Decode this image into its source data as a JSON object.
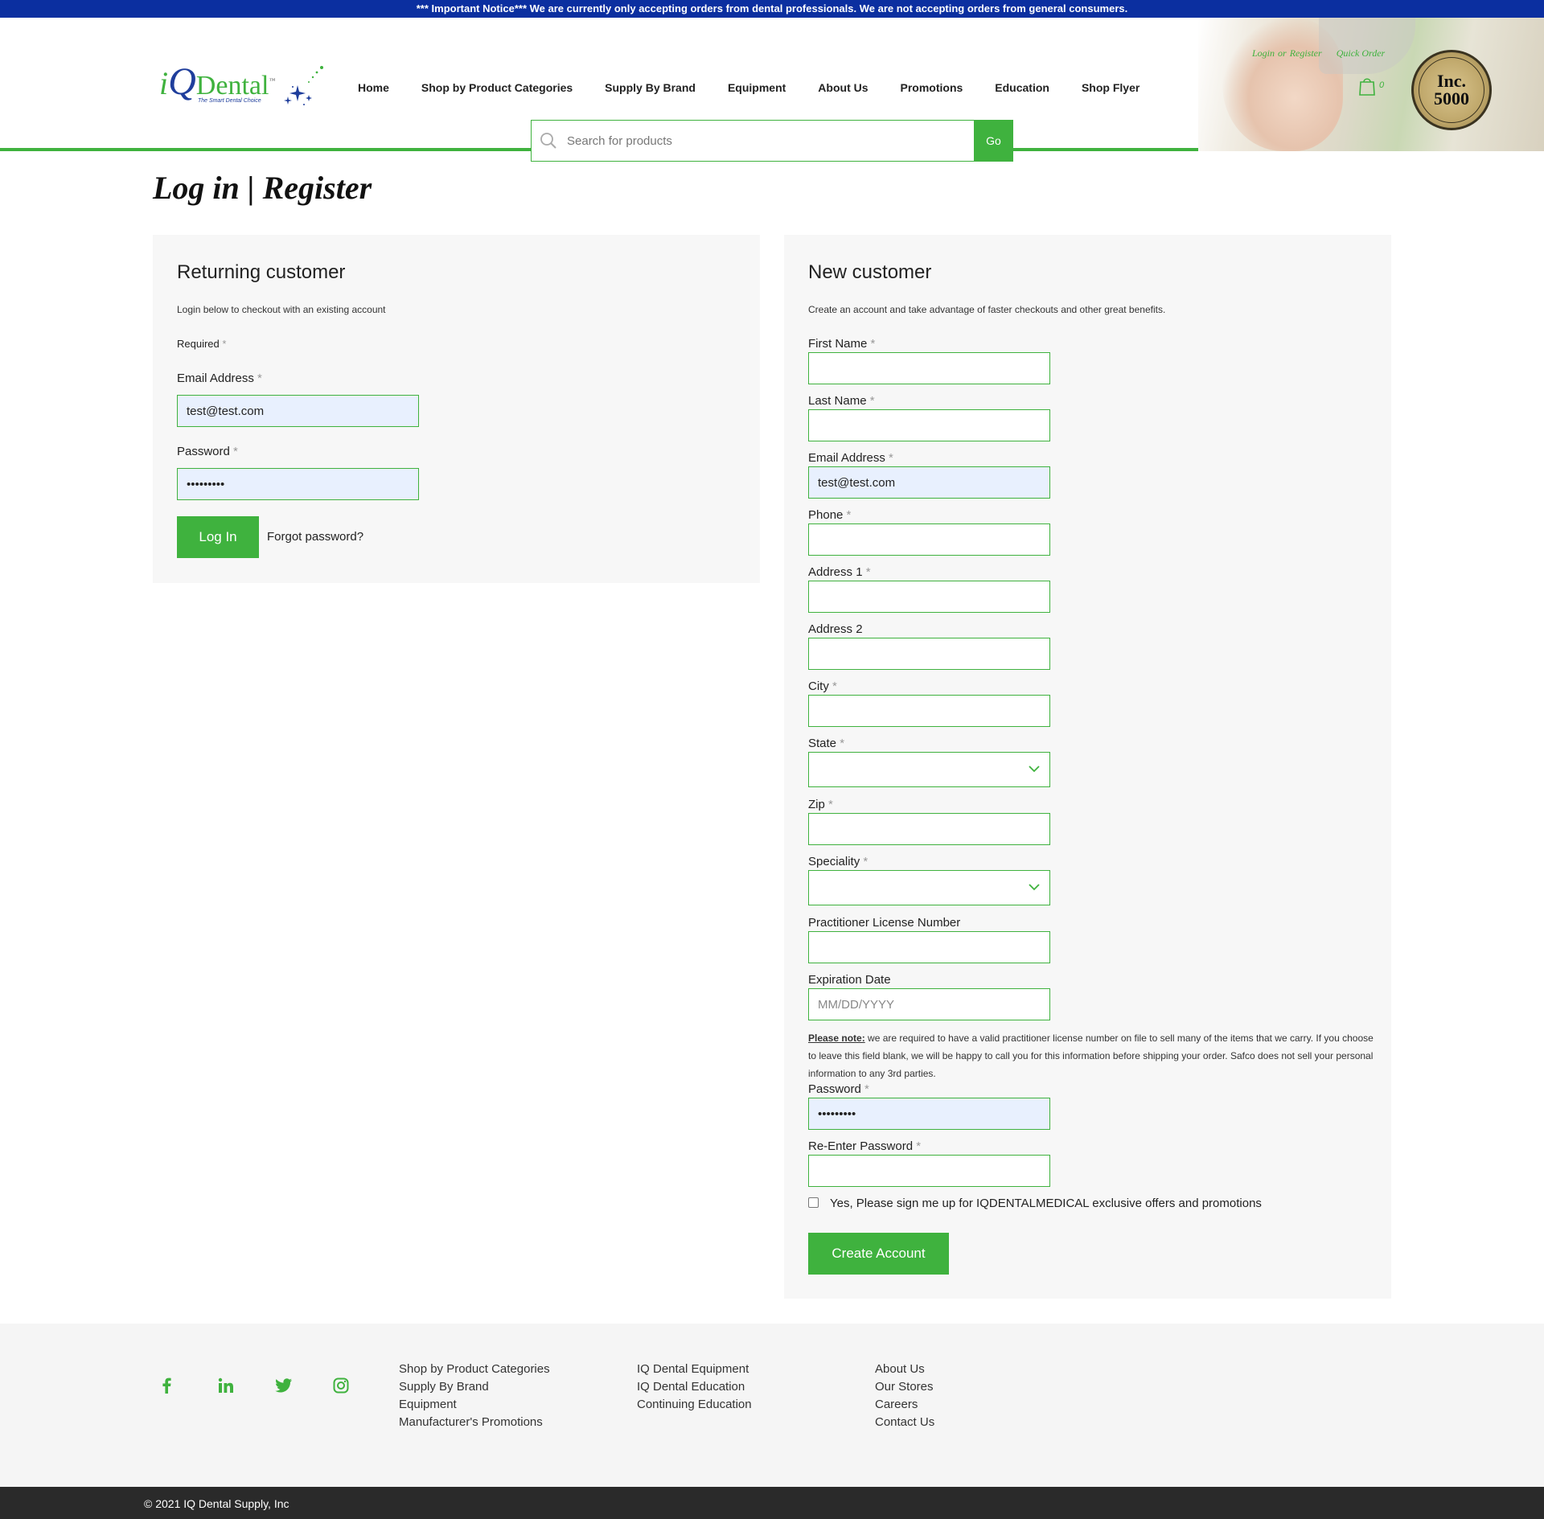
{
  "notice": "*** Important Notice*** We are currently only accepting orders from dental professionals. We are not accepting orders from general consumers.",
  "logo": {
    "i": "i",
    "q": "Q",
    "dental": "Dental",
    "tm": "™",
    "tagline": "The Smart Dental Choice"
  },
  "nav": [
    {
      "label": "Home"
    },
    {
      "label": "Shop by Product Categories"
    },
    {
      "label": "Supply By Brand"
    },
    {
      "label": "Equipment"
    },
    {
      "label": "About Us"
    },
    {
      "label": "Promotions"
    },
    {
      "label": "Education"
    },
    {
      "label": "Shop Flyer"
    }
  ],
  "search": {
    "placeholder": "Search for products",
    "button": "Go"
  },
  "top_links": {
    "login": "Login",
    "or": "or",
    "register": "Register",
    "quick_order": "Quick Order",
    "cart_count": "0"
  },
  "badge": {
    "inc": "Inc.",
    "number": "5000",
    "ring_text": "AMERICA'S FASTEST-GROWING PRIVATE COMPANIES"
  },
  "page_title": "Log in | Register",
  "returning": {
    "heading": "Returning customer",
    "desc": "Login below to checkout with an existing account",
    "required": "Required",
    "email_label": "Email Address",
    "email_value": "test@test.com",
    "password_label": "Password",
    "password_value": "•••••••••",
    "login_button": "Log In",
    "forgot": "Forgot password?"
  },
  "new_customer": {
    "heading": "New customer",
    "desc": "Create an account and take advantage of faster checkouts and other great benefits.",
    "first_name": "First Name",
    "last_name": "Last Name",
    "email": "Email Address",
    "email_value": "test@test.com",
    "phone": "Phone",
    "address1": "Address 1",
    "address2": "Address 2",
    "city": "City",
    "state": "State",
    "zip": "Zip",
    "speciality": "Speciality",
    "license": "Practitioner License Number",
    "expiration": "Expiration Date",
    "expiration_placeholder": "MM/DD/YYYY",
    "note_label": "Please note:",
    "note_text": " we are required to have a valid practitioner license number on file to sell many of the items that we carry. If you choose to leave this field blank, we will be happy to call you for this information before shipping your order. Safco does not sell your personal information to any 3rd parties.",
    "password": "Password",
    "password_value": "•••••••••",
    "reenter_password": "Re-Enter Password",
    "signup_label": "Yes, Please sign me up for IQDENTALMEDICAL exclusive offers and promotions",
    "create_button": "Create Account"
  },
  "asterisk": "*",
  "footer": {
    "col1": [
      "Shop by Product Categories",
      "Supply By Brand",
      "Equipment",
      "Manufacturer's Promotions"
    ],
    "col2": [
      "IQ Dental Equipment",
      "IQ Dental Education",
      "Continuing Education"
    ],
    "col3": [
      "About Us",
      "Our Stores",
      "Careers",
      "Contact Us"
    ],
    "social": [
      "facebook-icon",
      "linkedin-icon",
      "twitter-icon",
      "instagram-icon"
    ],
    "copyright": "© 2021 IQ Dental Supply, Inc"
  },
  "colors": {
    "brand_green": "#3fb23e",
    "notice_blue": "#0b2fa0",
    "footer_dark": "#2a2a2a"
  }
}
